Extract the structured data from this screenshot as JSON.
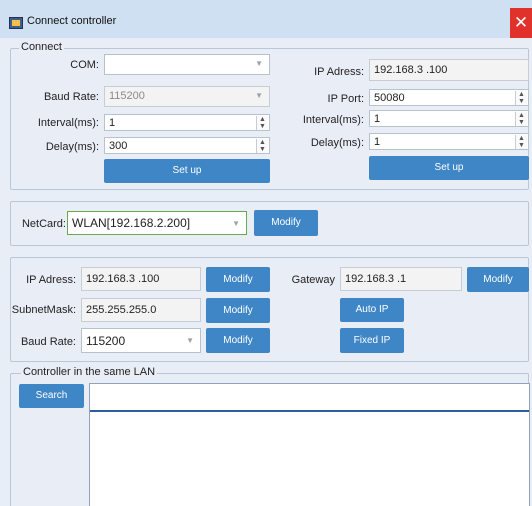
{
  "window": {
    "title": "Connect controller",
    "close": "✕"
  },
  "connect": {
    "legend": "Connect",
    "com": {
      "label": "COM:",
      "value": ""
    },
    "baud": {
      "label": "Baud Rate:",
      "value": "115200"
    },
    "interval_left": {
      "label": "Interval(ms):",
      "value": "1"
    },
    "delay_left": {
      "label": "Delay(ms):",
      "value": "300"
    },
    "setup_left": "Set up",
    "ip": {
      "label": "IP Adress:",
      "value": "192.168.3 .100"
    },
    "port": {
      "label": "IP Port:",
      "value": "50080"
    },
    "interval_right": {
      "label": "Interval(ms):",
      "value": "1"
    },
    "delay_right": {
      "label": "Delay(ms):",
      "value": "1"
    },
    "setup_right": "Set up"
  },
  "netcard": {
    "label": "NetCard:",
    "value": "WLAN[192.168.2.200]",
    "button": "Modify"
  },
  "network": {
    "ip": {
      "label": "IP Adress:",
      "value": "192.168.3 .100",
      "button": "Modify"
    },
    "subnet": {
      "label": "SubnetMask:",
      "value": "255.255.255.0",
      "button": "Modify"
    },
    "baud": {
      "label": "Baud Rate:",
      "value": "115200",
      "button": "Modify"
    },
    "gateway": {
      "label": "Gateway",
      "value": "192.168.3 .1",
      "button": "Modify"
    },
    "auto_ip": "Auto IP",
    "fixed_ip": "Fixed IP"
  },
  "lan": {
    "legend": "Controller in the same LAN",
    "search": "Search"
  },
  "colors": {
    "button": "#3f86c6",
    "title_bar": "#cfe0f3",
    "close": "#e0312b"
  }
}
